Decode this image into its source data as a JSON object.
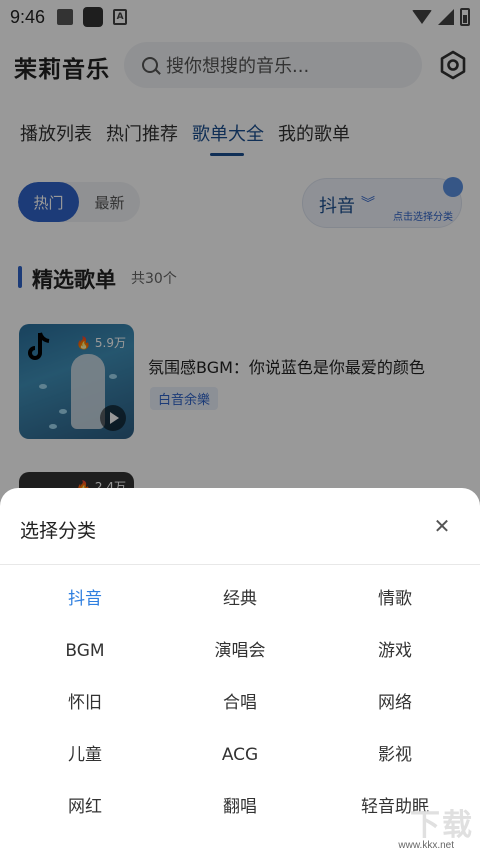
{
  "status_bar": {
    "time": "9:46"
  },
  "app": {
    "title": "茉莉音乐"
  },
  "search": {
    "placeholder": "搜你想搜的音乐..."
  },
  "tabs": [
    {
      "label": "播放列表"
    },
    {
      "label": "热门推荐"
    },
    {
      "label": "歌单大全",
      "active": true
    },
    {
      "label": "我的歌单"
    }
  ],
  "filter": {
    "segments": [
      "热门",
      "最新"
    ],
    "selected": "热门",
    "category_label": "抖音",
    "category_hint": "点击选择分类"
  },
  "section": {
    "title": "精选歌单",
    "count": "共30个"
  },
  "playlists": [
    {
      "plays": "5.9万",
      "title": "氛围感BGM：你说蓝色是你最爱的颜色",
      "tag": "白音余樂"
    },
    {
      "plays": "2.4万"
    }
  ],
  "sheet": {
    "title": "选择分类",
    "selected": "抖音",
    "categories": [
      "抖音",
      "经典",
      "情歌",
      "BGM",
      "演唱会",
      "游戏",
      "怀旧",
      "合唱",
      "网络",
      "儿童",
      "ACG",
      "影视",
      "网红",
      "翻唱",
      "轻音助眠"
    ]
  },
  "watermark": {
    "logo_text": "下载",
    "url": "www.kkx.net"
  },
  "colors": {
    "accent": "#2f63c8",
    "selected_category": "#2f7fe0",
    "overlay": "rgba(0,0,0,0.40)"
  }
}
